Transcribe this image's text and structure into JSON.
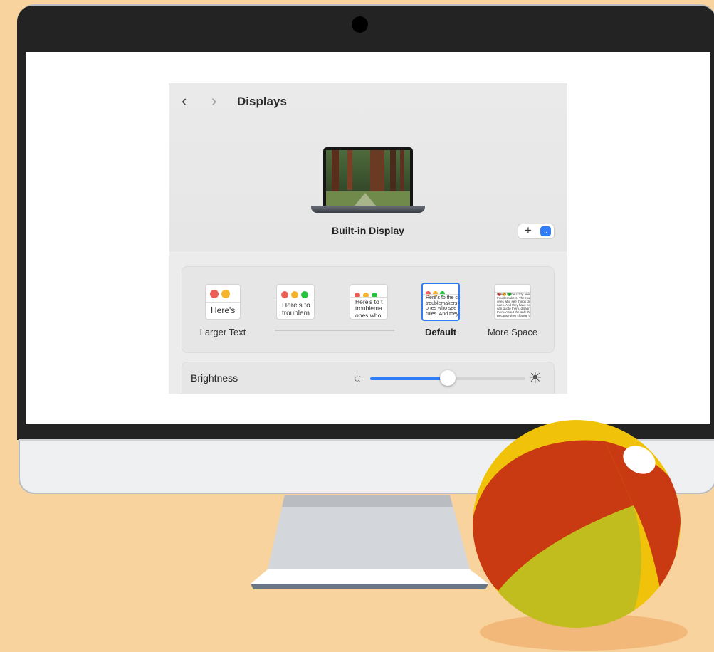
{
  "window": {
    "title": "Displays",
    "back_glyph": "‹",
    "forward_glyph": "›",
    "display_name": "Built-in Display",
    "add_glyph": "+",
    "add_chevron": "⌄"
  },
  "resolutions": {
    "options": [
      {
        "label": "Larger Text",
        "preview": "Here's",
        "selected": false
      },
      {
        "label": "",
        "preview": "Here's to\ntroublem",
        "selected": false
      },
      {
        "label": "",
        "preview": "Here's to t\ntroublema\nones who",
        "selected": false
      },
      {
        "label": "Default",
        "preview": "Here's to the cr\ntroublemakers.\nones who see t\nrules. And they",
        "selected": true
      },
      {
        "label": "More Space",
        "preview": "Here's to the crazy one\ntroublemakers. The rou\nones who see things di\nrules. And they have no\ncan quote them, disagr\nthem. About the only th\nBecause they change t",
        "selected": false
      }
    ]
  },
  "brightness": {
    "label": "Brightness",
    "level": 0.5,
    "icon_low": "sun-small-icon",
    "icon_high": "sun-large-icon"
  },
  "colors": {
    "accent": "#2f7cf6",
    "background": "#f8d39d",
    "dot_red": "#ec5f57",
    "dot_yellow": "#f4b42c",
    "dot_green": "#27c340"
  }
}
